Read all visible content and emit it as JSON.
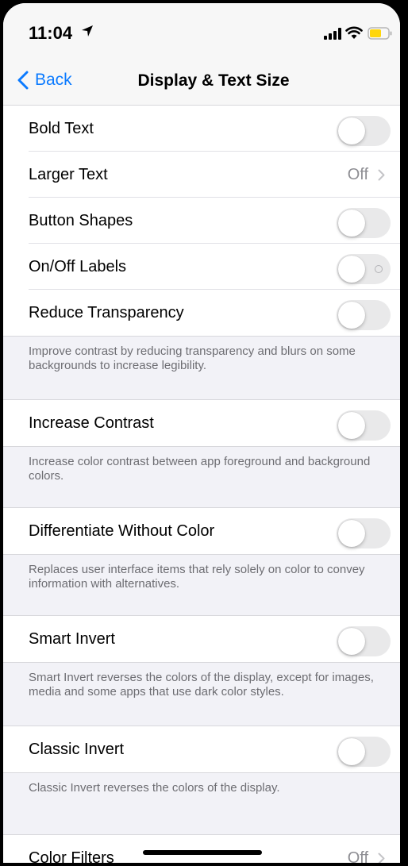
{
  "status": {
    "time": "11:04"
  },
  "nav": {
    "back_label": "Back",
    "title": "Display & Text Size"
  },
  "rows": {
    "bold_text": {
      "label": "Bold Text",
      "on": false
    },
    "larger_text": {
      "label": "Larger Text",
      "value": "Off"
    },
    "button_shapes": {
      "label": "Button Shapes",
      "on": false
    },
    "onoff_labels": {
      "label": "On/Off Labels",
      "on": false
    },
    "reduce_transparency": {
      "label": "Reduce Transparency",
      "on": false,
      "footnote": "Improve contrast by reducing transparency and blurs on some backgrounds to increase legibility."
    },
    "increase_contrast": {
      "label": "Increase Contrast",
      "on": false,
      "footnote": "Increase color contrast between app foreground and background colors."
    },
    "differentiate": {
      "label": "Differentiate Without Color",
      "on": false,
      "footnote": "Replaces user interface items that rely solely on color to convey information with alternatives."
    },
    "smart_invert": {
      "label": "Smart Invert",
      "on": false,
      "footnote": "Smart Invert reverses the colors of the display, except for images, media and some apps that use dark color styles."
    },
    "classic_invert": {
      "label": "Classic Invert",
      "on": false,
      "footnote": "Classic Invert reverses the colors of the display."
    },
    "color_filters": {
      "label": "Color Filters",
      "value": "Off"
    }
  },
  "colors": {
    "accent": "#0a7aff",
    "toggle_off": "#e9e9ea",
    "battery_low": "#ffd60a"
  },
  "icons": [
    "location-arrow-icon",
    "signal-icon",
    "wifi-icon",
    "battery-icon",
    "chevron-left-icon",
    "chevron-right-icon"
  ]
}
